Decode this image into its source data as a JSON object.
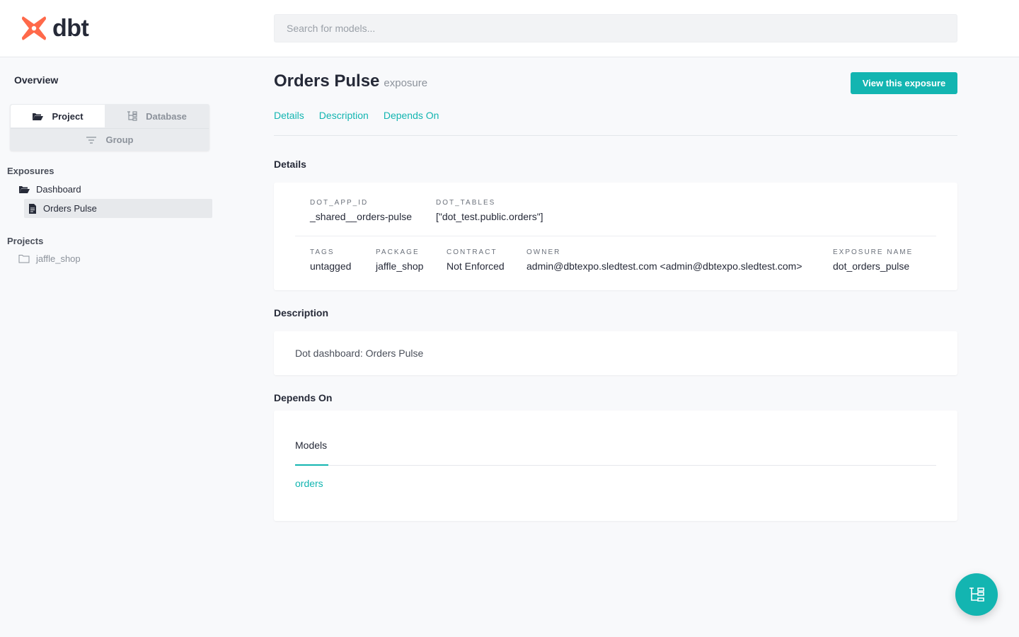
{
  "header": {
    "logo_text": "dbt",
    "search_placeholder": "Search for models..."
  },
  "sidebar": {
    "overview": "Overview",
    "segment": {
      "project": "Project",
      "database": "Database",
      "group": "Group"
    },
    "exposures_title": "Exposures",
    "exposures": {
      "folder": "Dashboard",
      "item": "Orders Pulse"
    },
    "projects_title": "Projects",
    "projects": [
      "jaffle_shop"
    ]
  },
  "main": {
    "title": "Orders Pulse",
    "subtitle": "exposure",
    "view_button": "View this exposure",
    "tabs": [
      "Details",
      "Description",
      "Depends On"
    ],
    "details": {
      "heading": "Details",
      "row1": [
        {
          "key": "DOT_APP_ID",
          "value": "_shared__orders-pulse"
        },
        {
          "key": "DOT_TABLES",
          "value": "[\"dot_test.public.orders\"]"
        }
      ],
      "row2": [
        {
          "key": "TAGS",
          "value": "untagged"
        },
        {
          "key": "PACKAGE",
          "value": "jaffle_shop"
        },
        {
          "key": "CONTRACT",
          "value": "Not Enforced"
        },
        {
          "key": "OWNER",
          "value": "admin@dbtexpo.sledtest.com <admin@dbtexpo.sledtest.com>"
        },
        {
          "key": "EXPOSURE NAME",
          "value": "dot_orders_pulse"
        }
      ]
    },
    "description": {
      "heading": "Description",
      "text": "Dot dashboard: Orders Pulse"
    },
    "depends_on": {
      "heading": "Depends On",
      "tab": "Models",
      "models": [
        "orders"
      ]
    }
  },
  "colors": {
    "accent": "#13b5b1",
    "logo": "#ff694a",
    "text": "#262a38"
  }
}
